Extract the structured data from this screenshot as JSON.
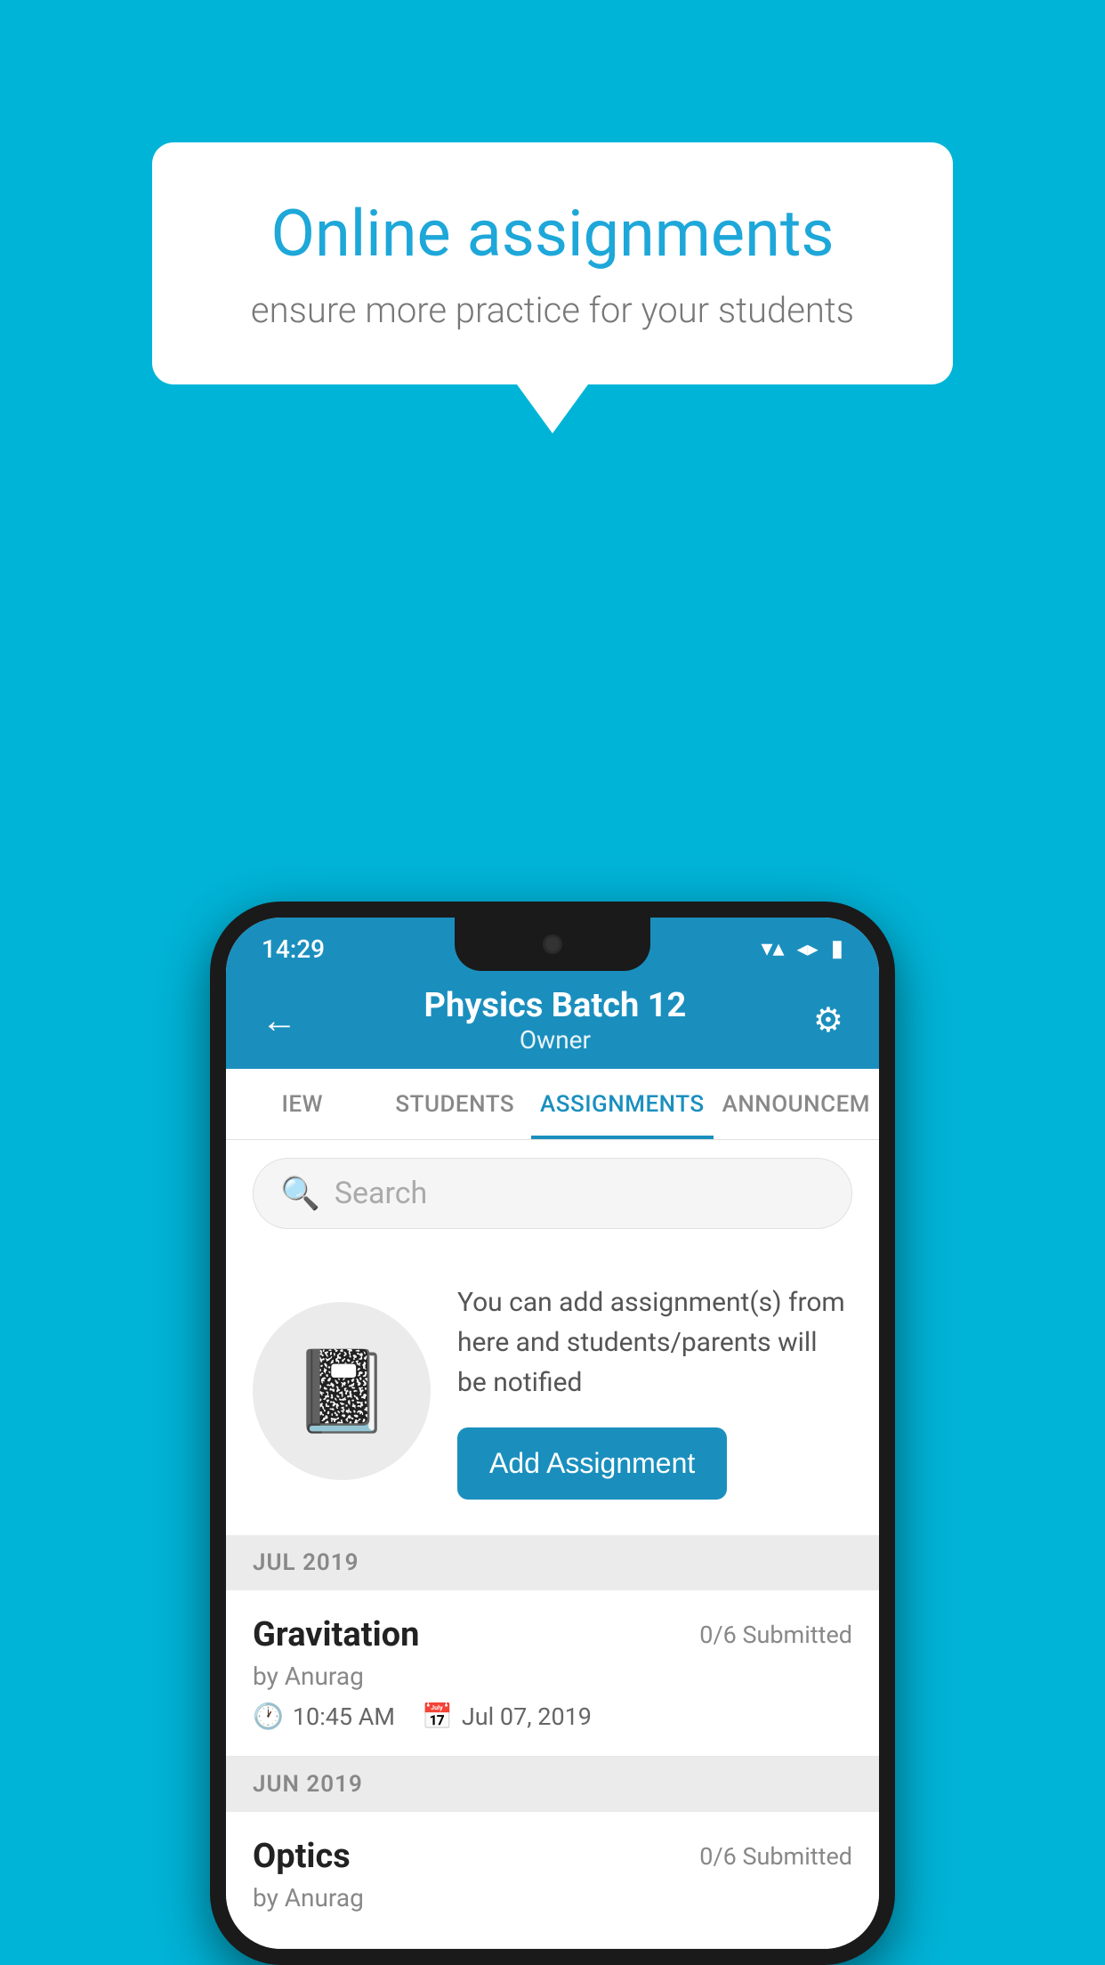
{
  "background_color": "#00B4D8",
  "speech_bubble": {
    "title": "Online assignments",
    "subtitle": "ensure more practice for your students"
  },
  "status_bar": {
    "time": "14:29",
    "wifi": "▼",
    "signal": "▲",
    "battery": "▐"
  },
  "header": {
    "title": "Physics Batch 12",
    "subtitle": "Owner",
    "back_label": "←",
    "settings_label": "⚙"
  },
  "tabs": [
    {
      "label": "IEW",
      "active": false
    },
    {
      "label": "STUDENTS",
      "active": false
    },
    {
      "label": "ASSIGNMENTS",
      "active": true
    },
    {
      "label": "ANNOUNCEM",
      "active": false
    }
  ],
  "search": {
    "placeholder": "Search"
  },
  "promo": {
    "text": "You can add assignment(s) from here and students/parents will be notified",
    "button_label": "Add Assignment"
  },
  "sections": [
    {
      "label": "JUL 2019",
      "assignments": [
        {
          "name": "Gravitation",
          "submitted": "0/6 Submitted",
          "author": "by Anurag",
          "time": "10:45 AM",
          "date": "Jul 07, 2019"
        }
      ]
    },
    {
      "label": "JUN 2019",
      "assignments": [
        {
          "name": "Optics",
          "submitted": "0/6 Submitted",
          "author": "by Anurag",
          "time": "",
          "date": ""
        }
      ]
    }
  ]
}
